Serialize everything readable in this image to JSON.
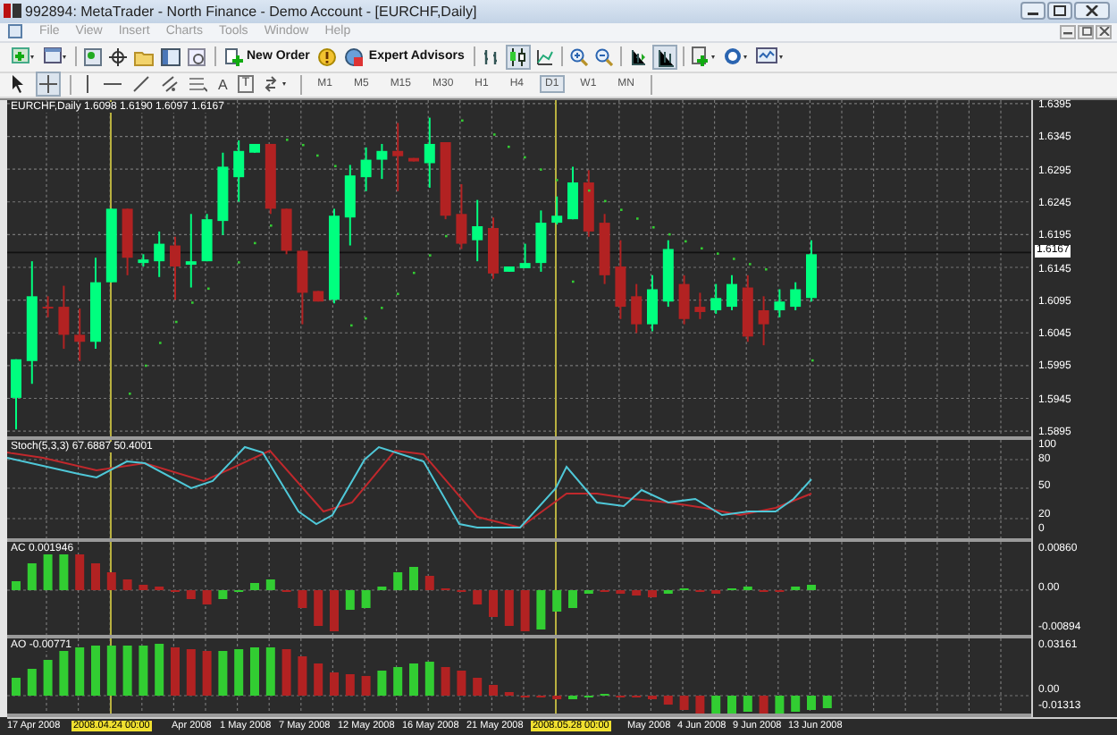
{
  "window": {
    "title": "992894: MetaTrader - North Finance - Demo Account - [EURCHF,Daily]"
  },
  "menu": [
    {
      "label": "File",
      "disabled": true
    },
    {
      "label": "View",
      "disabled": true
    },
    {
      "label": "Insert",
      "disabled": true
    },
    {
      "label": "Charts",
      "disabled": true
    },
    {
      "label": "Tools",
      "disabled": true
    },
    {
      "label": "Window",
      "disabled": true
    },
    {
      "label": "Help",
      "disabled": true
    }
  ],
  "toolbar": {
    "new_order": "New Order",
    "expert_advisors": "Expert Advisors",
    "text_tool": "A",
    "label_tool": "T"
  },
  "timeframes": [
    {
      "label": "M1",
      "selected": false
    },
    {
      "label": "M5",
      "selected": false
    },
    {
      "label": "M15",
      "selected": false
    },
    {
      "label": "M30",
      "selected": false
    },
    {
      "label": "H1",
      "selected": false
    },
    {
      "label": "H4",
      "selected": false
    },
    {
      "label": "D1",
      "selected": true
    },
    {
      "label": "W1",
      "selected": false
    },
    {
      "label": "MN",
      "selected": false
    }
  ],
  "chart": {
    "header": "EURCHF,Daily  1.6098 1.6190 1.6097 1.6167",
    "current_price": "1.6167",
    "price_ticks": [
      "1.6395",
      "1.6345",
      "1.6295",
      "1.6245",
      "1.6195",
      "1.6145",
      "1.6095",
      "1.6045",
      "1.5995",
      "1.5945",
      "1.5895"
    ]
  },
  "indicators": [
    {
      "kind": "stochastic",
      "label": "Stoch(5,3,3) 67.6887 50.4001",
      "ticks": [
        "100",
        "80",
        "50",
        "20",
        "0"
      ]
    },
    {
      "kind": "ac",
      "label": "AC 0.001946",
      "ticks": [
        "0.00860",
        "0.00",
        "-0.00894"
      ]
    },
    {
      "kind": "ao",
      "label": "AO -0.00771",
      "ticks": [
        "0.03161",
        "0.00",
        "-0.01313"
      ]
    }
  ],
  "time_axis": [
    {
      "label": "17 Apr 2008",
      "highlighted": false
    },
    {
      "label": "2008.04.24 00:00",
      "highlighted": true
    },
    {
      "label": "Apr 2008",
      "highlighted": false
    },
    {
      "label": "1 May 2008",
      "highlighted": false
    },
    {
      "label": "7 May 2008",
      "highlighted": false
    },
    {
      "label": "12 May 2008",
      "highlighted": false
    },
    {
      "label": "16 May 2008",
      "highlighted": false
    },
    {
      "label": "21 May 2008",
      "highlighted": false
    },
    {
      "label": "2008.05.28 00:00",
      "highlighted": true
    },
    {
      "label": "May 2008",
      "highlighted": false
    },
    {
      "label": "4 Jun 2008",
      "highlighted": false
    },
    {
      "label": "9 Jun 2008",
      "highlighted": false
    },
    {
      "label": "13 Jun 2008",
      "highlighted": false
    }
  ]
}
